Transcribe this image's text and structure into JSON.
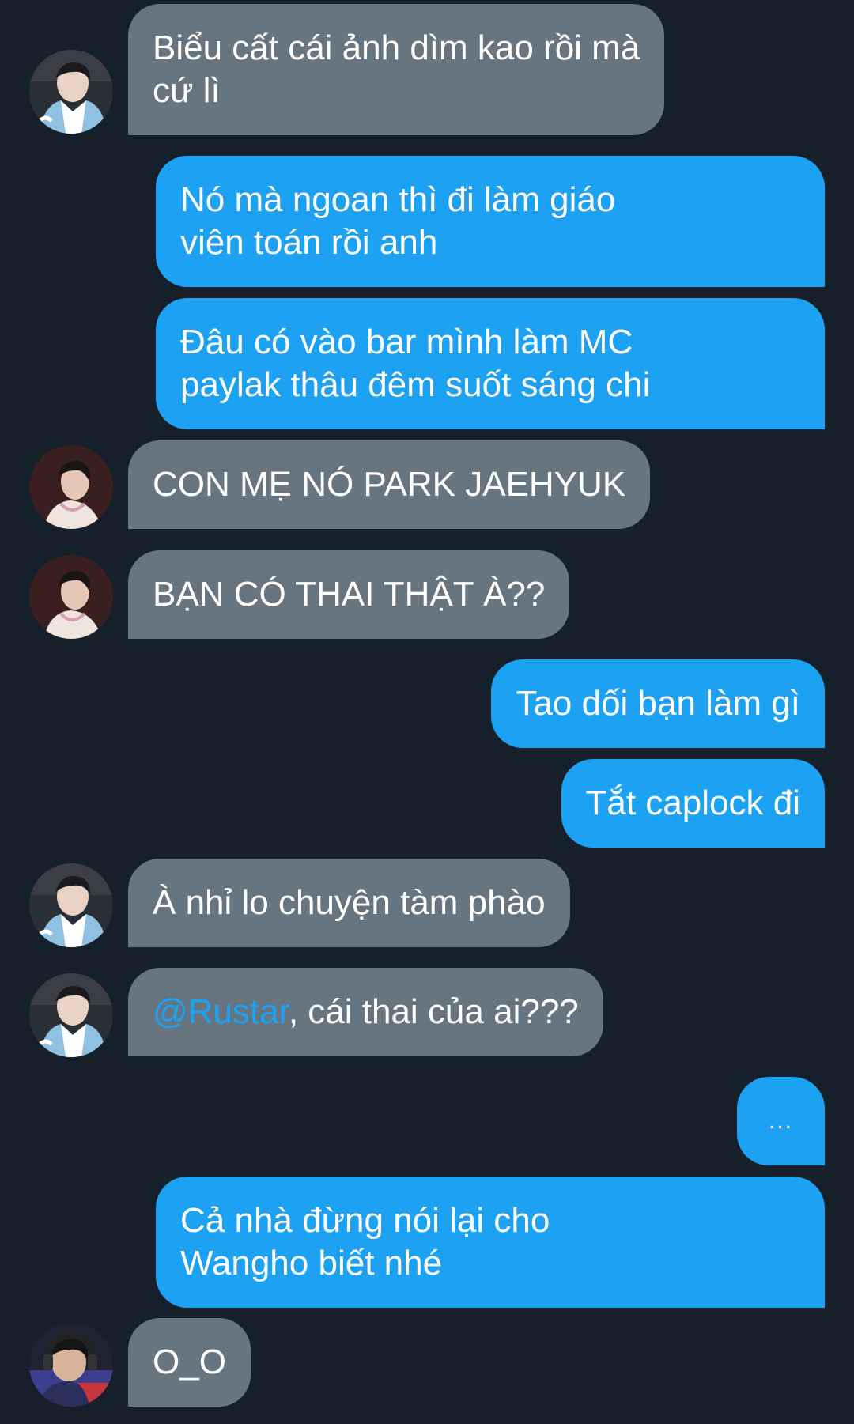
{
  "colors": {
    "background": "#15202b",
    "incoming_bubble": "#66757f",
    "outgoing_bubble": "#1da1f2",
    "mention": "#1da1f2",
    "text": "#ffffff"
  },
  "messages": [
    {
      "side": "in",
      "avatar": "avatar-hanbok-blue-icon",
      "lines": [
        "Biểu cất cái ảnh dìm kao rồi mà",
        "cứ lì"
      ]
    },
    {
      "side": "out",
      "lines": [
        "Nó mà ngoan thì đi làm giáo",
        "viên toán rồi anh"
      ]
    },
    {
      "side": "out",
      "lines": [
        "Đâu có vào bar mình làm MC",
        "paylak thâu đêm suốt sáng chi"
      ]
    },
    {
      "side": "in",
      "avatar": "avatar-profile-dark-icon",
      "lines": [
        "CON MẸ NÓ PARK JAEHYUK"
      ]
    },
    {
      "side": "in",
      "avatar": "avatar-profile-dark-icon",
      "lines": [
        "BẠN CÓ THAI THẬT À??"
      ]
    },
    {
      "side": "out",
      "lines": [
        "Tao dối bạn làm gì"
      ]
    },
    {
      "side": "out",
      "lines": [
        "Tắt caplock đi"
      ]
    },
    {
      "side": "in",
      "avatar": "avatar-hanbok-blue-icon",
      "lines": [
        "À nhỉ lo chuyện tàm phào"
      ]
    },
    {
      "side": "in",
      "avatar": "avatar-hanbok-blue-icon",
      "mention": "@Rustar",
      "rest": ", cái thai của ai???"
    },
    {
      "side": "out",
      "lines": [
        "..."
      ]
    },
    {
      "side": "out",
      "lines": [
        "Cả nhà đừng nói lại cho",
        "Wangho biết nhé"
      ]
    },
    {
      "side": "in",
      "avatar": "avatar-headset-gamer-icon",
      "lines": [
        "O_O"
      ]
    }
  ]
}
